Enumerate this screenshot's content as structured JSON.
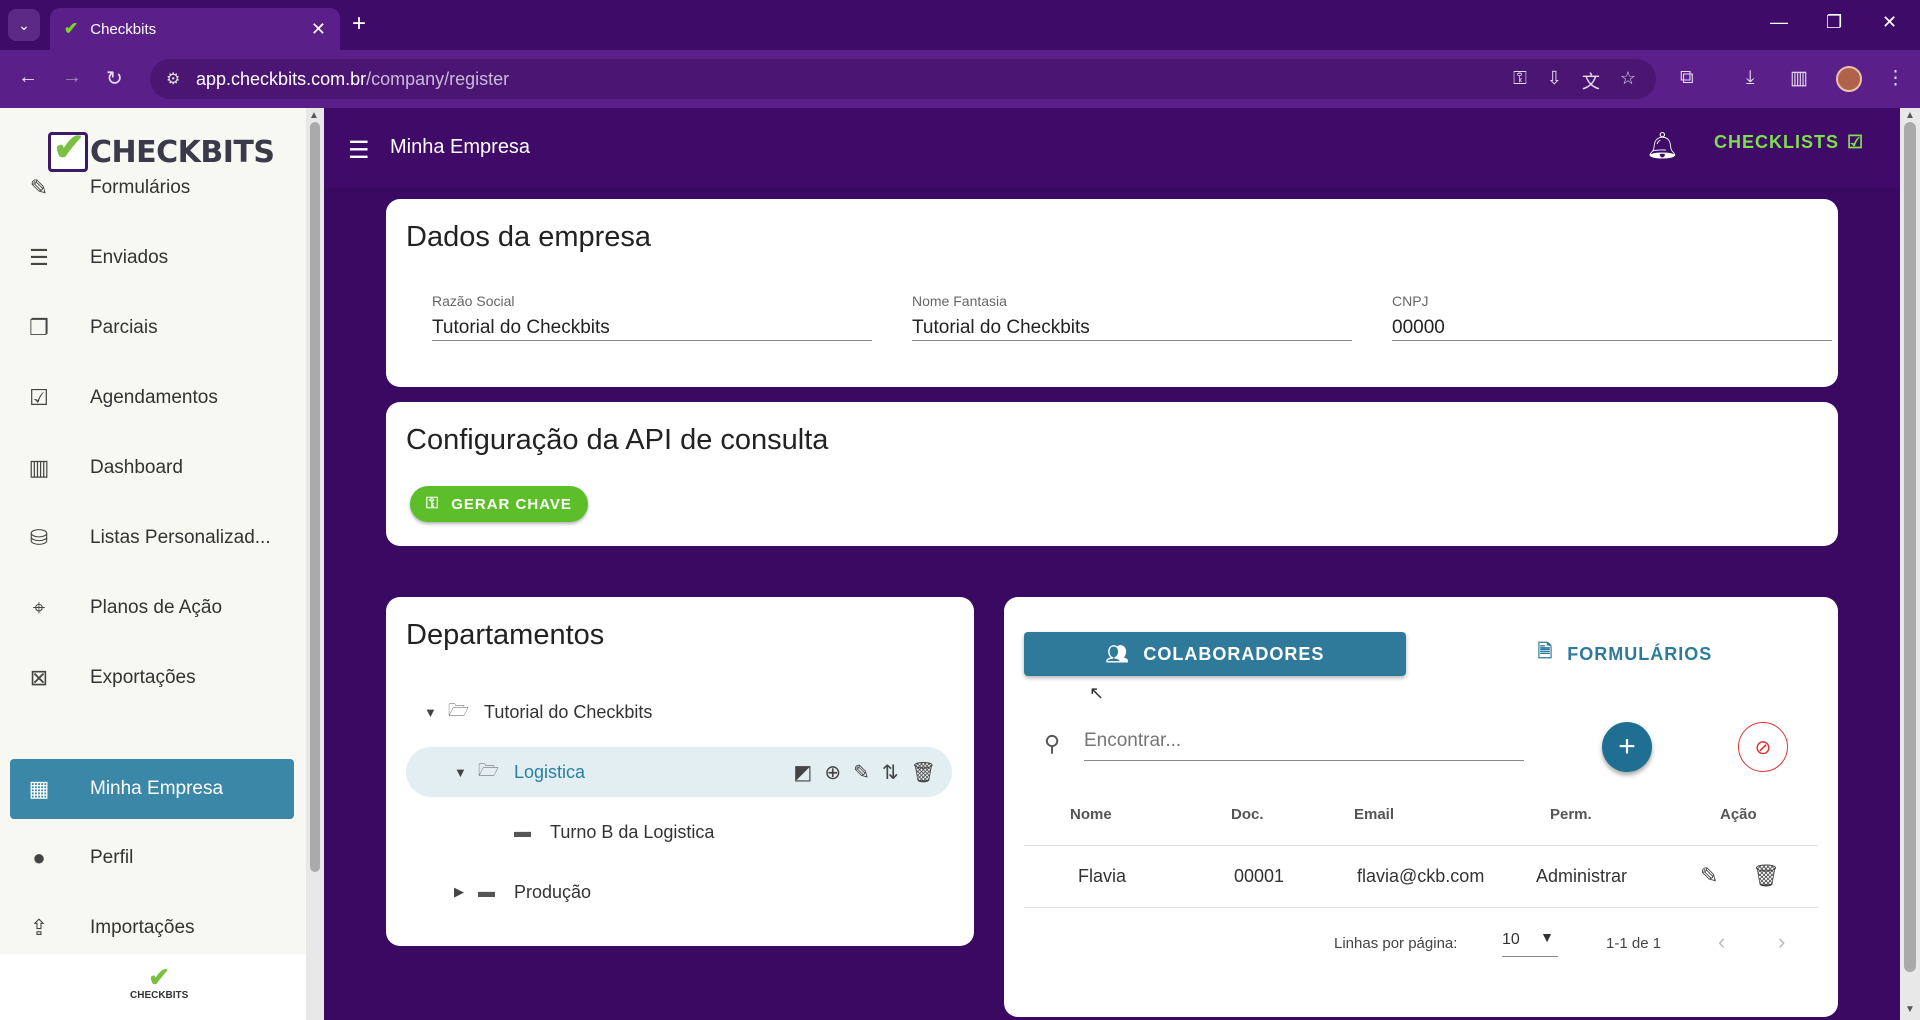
{
  "browser": {
    "tab_title": "Checkbits",
    "url_host": "app.checkbits.com.br",
    "url_path": "/company/register"
  },
  "sidebar": {
    "logo_text": "CHECKBITS",
    "footer_logo_text": "CHECKBITS",
    "items": [
      {
        "label": "Formulários",
        "icon": "form-edit-icon"
      },
      {
        "label": "Enviados",
        "icon": "sent-list-icon"
      },
      {
        "label": "Parciais",
        "icon": "partial-docs-icon"
      },
      {
        "label": "Agendamentos",
        "icon": "calendar-check-icon"
      },
      {
        "label": "Dashboard",
        "icon": "bar-chart-icon"
      },
      {
        "label": "Listas Personalizad...",
        "icon": "database-icon"
      },
      {
        "label": "Planos de Ação",
        "icon": "crosshair-icon"
      },
      {
        "label": "Exportações",
        "icon": "excel-file-icon"
      },
      {
        "label": "Minha Empresa",
        "icon": "building-icon",
        "active": true
      },
      {
        "label": "Perfil",
        "icon": "person-icon"
      },
      {
        "label": "Importações",
        "icon": "file-import-icon"
      }
    ]
  },
  "header": {
    "title": "Minha Empresa",
    "checklists_label": "CHECKLISTS"
  },
  "company": {
    "title": "Dados da empresa",
    "fields": [
      {
        "label": "Razão Social",
        "value": "Tutorial do Checkbits"
      },
      {
        "label": "Nome Fantasia",
        "value": "Tutorial do Checkbits"
      },
      {
        "label": "CNPJ",
        "value": "00000"
      }
    ]
  },
  "api": {
    "title": "Configuração da API de consulta",
    "button_label": "GERAR CHAVE"
  },
  "departments": {
    "title": "Departamentos",
    "tree": [
      {
        "label": "Tutorial do Checkbits",
        "level": 0,
        "expanded": true
      },
      {
        "label": "Logistica",
        "level": 1,
        "expanded": true,
        "selected": true
      },
      {
        "label": "Turno B da Logistica",
        "level": 2
      },
      {
        "label": "Produção",
        "level": 1,
        "expanded": false
      }
    ]
  },
  "people": {
    "tab_collaborators": "COLABORADORES",
    "tab_forms": "FORMULÁRIOS",
    "search_placeholder": "Encontrar...",
    "columns": [
      "Nome",
      "Doc.",
      "Email",
      "Perm.",
      "Ação"
    ],
    "rows": [
      {
        "name": "Flavia",
        "doc": "00001",
        "email": "flavia@ckb.com",
        "perm": "Administrar"
      }
    ],
    "rows_per_page_label": "Linhas por página:",
    "rows_per_page": "10",
    "range": "1-1 de 1"
  },
  "colors": {
    "header_bg": "#3f0a68",
    "accent_blue": "#2f7a9a",
    "accent_green": "#5cbf2a"
  }
}
